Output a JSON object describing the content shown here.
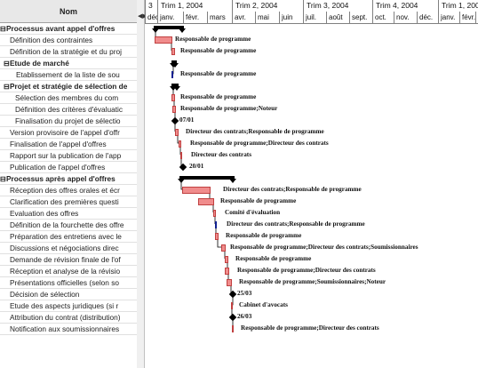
{
  "task_table": {
    "header": "Nom",
    "rows": [
      {
        "text": "Processus avant appel d'offres",
        "summary": true,
        "twisty": "⊟",
        "indent": 0
      },
      {
        "text": "Définition des contraintes",
        "summary": false,
        "twisty": "",
        "indent": 1
      },
      {
        "text": "Définition de la stratégie et du proj",
        "summary": false,
        "twisty": "",
        "indent": 1
      },
      {
        "text": "Etude de marché",
        "summary": true,
        "twisty": "⊟",
        "indent": 1
      },
      {
        "text": "Etablissement de la liste de sou",
        "summary": false,
        "twisty": "",
        "indent": 2
      },
      {
        "text": "Projet et stratégie de sélection de",
        "summary": true,
        "twisty": "⊟",
        "indent": 1
      },
      {
        "text": "Sélection des membres du com",
        "summary": false,
        "twisty": "",
        "indent": 2
      },
      {
        "text": "Définition des critères d'évaluatic",
        "summary": false,
        "twisty": "",
        "indent": 2
      },
      {
        "text": "Finalisation du projet de sélectio",
        "summary": false,
        "twisty": "",
        "indent": 2
      },
      {
        "text": "Version provisoire de l'appel d'offr",
        "summary": false,
        "twisty": "",
        "indent": 1
      },
      {
        "text": "Finalisation de l'appel d'offres",
        "summary": false,
        "twisty": "",
        "indent": 1
      },
      {
        "text": "Rapport sur la publication de l'app",
        "summary": false,
        "twisty": "",
        "indent": 1
      },
      {
        "text": "Publication de l'appel d'offres",
        "summary": false,
        "twisty": "",
        "indent": 1
      },
      {
        "text": "Processus après appel d'offres",
        "summary": true,
        "twisty": "⊟",
        "indent": 0
      },
      {
        "text": "Réception des offres orales et écr",
        "summary": false,
        "twisty": "",
        "indent": 1
      },
      {
        "text": "Clarification des premières questi",
        "summary": false,
        "twisty": "",
        "indent": 1
      },
      {
        "text": "Evaluation des offres",
        "summary": false,
        "twisty": "",
        "indent": 1
      },
      {
        "text": "Définition de la fourchette des offre",
        "summary": false,
        "twisty": "",
        "indent": 1
      },
      {
        "text": "Préparation des entretiens avec le",
        "summary": false,
        "twisty": "",
        "indent": 1
      },
      {
        "text": "Discussions et négociations direc",
        "summary": false,
        "twisty": "",
        "indent": 1
      },
      {
        "text": "Demande de révision finale de l'of",
        "summary": false,
        "twisty": "",
        "indent": 1
      },
      {
        "text": "Réception et analyse de la révisio",
        "summary": false,
        "twisty": "",
        "indent": 1
      },
      {
        "text": "Présentations officielles (selon so",
        "summary": false,
        "twisty": "",
        "indent": 1
      },
      {
        "text": "Décision de sélection",
        "summary": false,
        "twisty": "",
        "indent": 1
      },
      {
        "text": "Etude des aspects juridiques (si r",
        "summary": false,
        "twisty": "",
        "indent": 1
      },
      {
        "text": "Attribution du contrat (distribution)",
        "summary": false,
        "twisty": "",
        "indent": 1
      },
      {
        "text": "Notification aux soumissionnaires",
        "summary": false,
        "twisty": "",
        "indent": 1
      }
    ]
  },
  "splitter": {
    "arrow": "◀▶"
  },
  "timeline": {
    "quarters": [
      "3",
      "Trim 1, 2004",
      "Trim 2, 2004",
      "Trim 3, 2004",
      "Trim 4, 2004",
      "Trim 1, 2005"
    ],
    "months": [
      "déc.",
      "janv.",
      "févr.",
      "mars",
      "avr.",
      "mai",
      "juin",
      "juil.",
      "août",
      "sept.",
      "oct.",
      "nov.",
      "déc.",
      "janv.",
      "févr.",
      "m"
    ]
  },
  "gantt": {
    "colors": {
      "bar_fill": "#f08c8c",
      "bar_border": "#c04040",
      "milestone_bar": "#3050d0",
      "summary": "#000000"
    },
    "row_labels": [
      "",
      "Responsable de programme",
      "Responsable de programme",
      "",
      "Responsable de programme",
      "",
      "Responsable de programme",
      "Responsable de programme;Noteur",
      "07/01",
      "Directeur des contrats;Responsable de programme",
      "Responsable de programme;Directeur des contrats",
      "Directeur des contrats",
      "20/01",
      "",
      "Directeur des contrats;Responsable de programme",
      "Responsable de programme",
      "Comité d'évaluation",
      "Directeur des contrats;Responsable de programme",
      "Responsable de programme",
      "Responsable de programme;Directeur des contrats;Soumissionnaires",
      "Responsable de programme",
      "Responsable de programme;Directeur des contrats",
      "Responsable de programme;Soumissionnaires;Noteur",
      "25/03",
      "Cabinet d'avocats",
      "26/03",
      "Responsable de programme;Directeur des contrats"
    ]
  }
}
